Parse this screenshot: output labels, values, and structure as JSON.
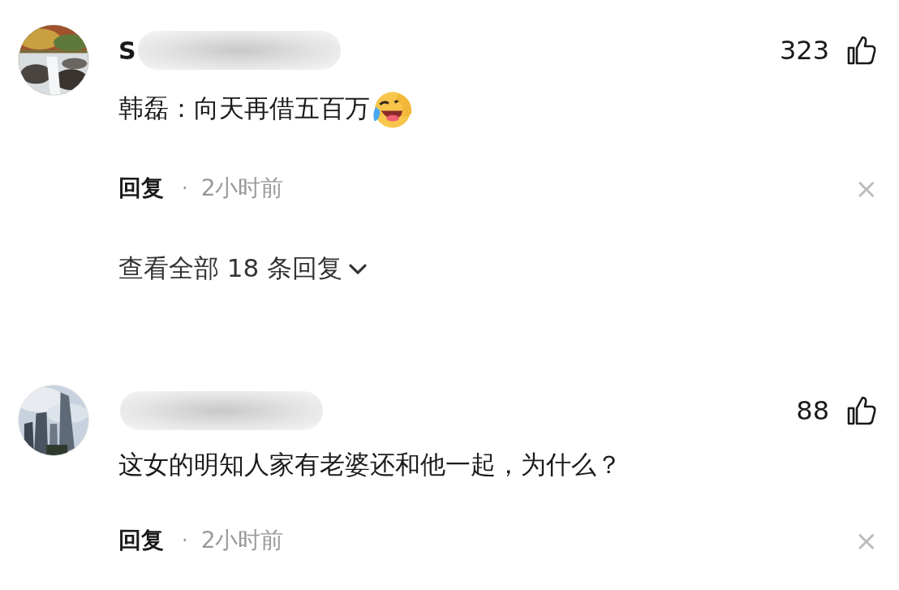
{
  "comments": [
    {
      "author": "S",
      "author_blurred": true,
      "likes": "323",
      "text": "韩磊：向天再借五百万",
      "emoji": true,
      "reply_label": "回复",
      "separator": "·",
      "time": "2小时前",
      "close": "×",
      "view_replies": "查看全部 18 条回复"
    },
    {
      "author_blurred": true,
      "likes": "88",
      "text": "这女的明知人家有老婆还和他一起，为什么？",
      "emoji": false,
      "reply_label": "回复",
      "separator": "·",
      "time": "2小时前",
      "close": "×"
    }
  ]
}
